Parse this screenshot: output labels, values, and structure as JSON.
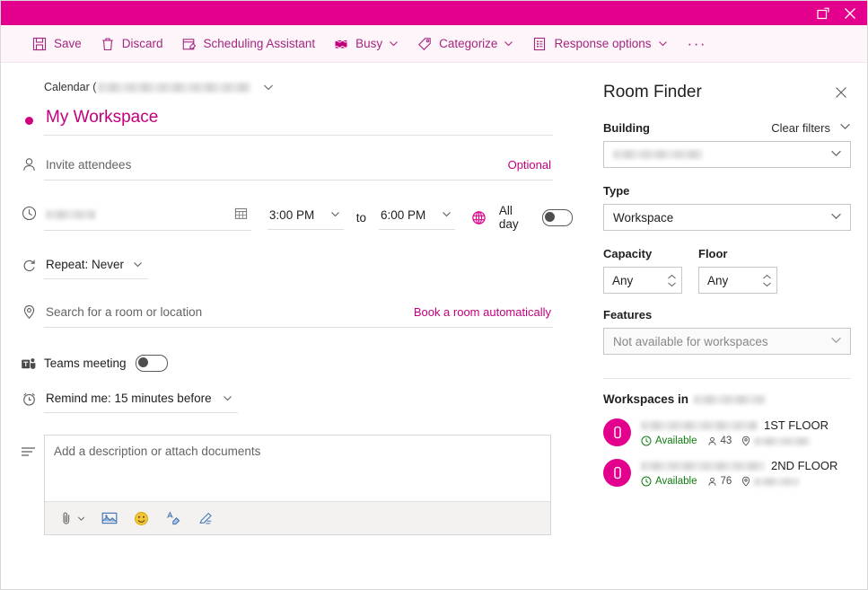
{
  "titlebar": {
    "popout_label": "Open in new window",
    "close_label": "Close",
    "bg_color": "#e3008c"
  },
  "toolbar": {
    "items": [
      {
        "label": "Save",
        "icon": "save-icon",
        "chevron": false
      },
      {
        "label": "Discard",
        "icon": "trash-icon",
        "chevron": false
      },
      {
        "label": "Scheduling Assistant",
        "icon": "scheduling-assistant-icon",
        "chevron": false
      },
      {
        "label": "Busy",
        "icon": "busy-icon",
        "chevron": true
      },
      {
        "label": "Categorize",
        "icon": "tag-icon",
        "chevron": true
      },
      {
        "label": "Response options",
        "icon": "response-options-icon",
        "chevron": true
      }
    ],
    "overflow_label": "···"
  },
  "form": {
    "calendar": {
      "label": "Calendar (",
      "value_redacted": true,
      "chevron": "chevron-down-icon"
    },
    "title": {
      "value": "My Workspace",
      "color": "#c2007c"
    },
    "attendees": {
      "placeholder": "Invite attendees",
      "optional_label": "Optional"
    },
    "datetime": {
      "date_redacted": true,
      "start_time": "3:00 PM",
      "separator": "to",
      "end_time": "6:00 PM",
      "allday_label": "All day",
      "allday_on": false,
      "timezone_icon": "globe-icon",
      "calendar_icon": "calendar-icon"
    },
    "repeat": {
      "label": "Repeat: Never"
    },
    "location": {
      "placeholder": "Search for a room or location",
      "book_link": "Book a room automatically"
    },
    "teams": {
      "label": "Teams meeting",
      "on": false
    },
    "reminder": {
      "label": "Remind me: 15 minutes before"
    },
    "description": {
      "placeholder": "Add a description or attach documents",
      "tools": [
        {
          "name": "attach-icon",
          "chevron": true
        },
        {
          "name": "insert-picture-icon",
          "chevron": false
        },
        {
          "name": "emoji-icon",
          "chevron": false
        },
        {
          "name": "highlight-icon",
          "chevron": false
        },
        {
          "name": "ink-pen-icon",
          "chevron": false
        }
      ]
    }
  },
  "room_finder": {
    "title": "Room Finder",
    "close_label": "Close",
    "building_label": "Building",
    "clear_filters_label": "Clear filters",
    "building_value_redacted": true,
    "type_label": "Type",
    "type_value": "Workspace",
    "capacity_label": "Capacity",
    "capacity_value": "Any",
    "floor_label": "Floor",
    "floor_value": "Any",
    "features_label": "Features",
    "features_value": "Not available for workspaces",
    "features_disabled": true,
    "results_heading": "Workspaces in",
    "results_heading_redacted": true,
    "results": [
      {
        "name_redacted": true,
        "floor": "1ST FLOOR",
        "status": "Available",
        "status_color": "#107c10",
        "capacity": "43",
        "location_redacted": true
      },
      {
        "name_redacted": true,
        "floor": "2ND FLOOR",
        "status": "Available",
        "status_color": "#107c10",
        "capacity": "76",
        "location_redacted": true
      }
    ]
  }
}
